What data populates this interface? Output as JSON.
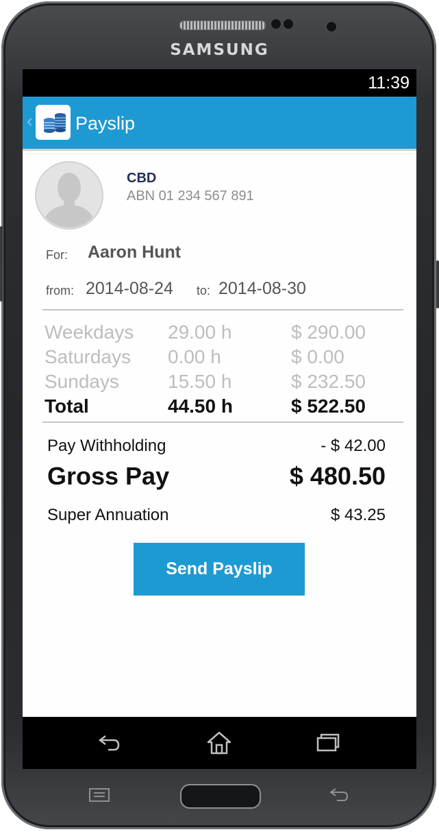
{
  "device": {
    "brand": "SAMSUNG"
  },
  "status_bar": {
    "time": "11:39"
  },
  "app_bar": {
    "title": "Payslip",
    "icon": "coin-stack-icon",
    "back_icon": "chevron-left-icon"
  },
  "employer": {
    "name": "CBD",
    "abn": "ABN 01 234 567 891",
    "avatar": "person-silhouette-icon"
  },
  "employee": {
    "for_label": "For:",
    "name": "Aaron Hunt"
  },
  "period": {
    "from_label": "from:",
    "from_date": "2014-08-24",
    "to_label": "to:",
    "to_date": "2014-08-30"
  },
  "hours": [
    {
      "day": "Weekdays",
      "hours": "29.00 h",
      "amount": "$ 290.00"
    },
    {
      "day": "Saturdays",
      "hours": "0.00 h",
      "amount": "$ 0.00"
    },
    {
      "day": "Sundays",
      "hours": "15.50 h",
      "amount": "$ 232.50"
    }
  ],
  "total": {
    "label": "Total",
    "hours": "44.50 h",
    "amount": "$ 522.50"
  },
  "summary": {
    "withholding_label": "Pay Withholding",
    "withholding_value": "- $ 42.00",
    "gross_label": "Gross Pay",
    "gross_value": "$ 480.50",
    "super_label": "Super Annuation",
    "super_value": "$ 43.25"
  },
  "actions": {
    "send_label": "Send Payslip"
  },
  "nav": {
    "back_icon": "back-arrow-icon",
    "home_icon": "home-icon",
    "recents_icon": "recent-apps-icon"
  },
  "colors": {
    "accent": "#1e9ad3",
    "total_text": "#111111",
    "muted_text": "#bdbdbd"
  }
}
